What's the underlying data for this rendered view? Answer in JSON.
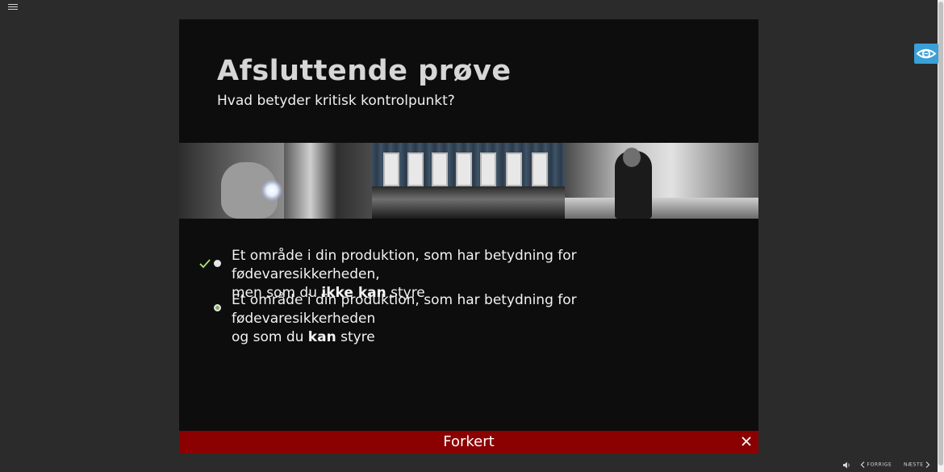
{
  "toolbar": {
    "menu_icon": "hamburger-menu-icon"
  },
  "slide": {
    "title": "Afsluttende prøve",
    "subtitle": "Hvad betyder kritisk kontrolpunkt?",
    "images": [
      {
        "name": "hand-with-light-photo"
      },
      {
        "name": "row-of-doors-photo"
      },
      {
        "name": "kitchen-chef-photo"
      }
    ],
    "options": [
      {
        "line1": "Et område i din produktion, som har betydning for fødevaresikkerheden,",
        "line2_pre": "men som du ",
        "line2_bold": "ikke kan",
        "line2_post": " styre",
        "marked_correct": true,
        "selected": false
      },
      {
        "line1": "Et område i din produktion, som har betydning for fødevaresikkerheden",
        "line2_pre": "og som du ",
        "line2_bold": "kan",
        "line2_post": " styre",
        "marked_correct": false,
        "selected": true
      }
    ],
    "feedback": {
      "text": "Forkert",
      "color": "#8b0000"
    }
  },
  "accessibility": {
    "icon": "eye-accessibility-icon",
    "color": "#3aa0d6"
  },
  "footer": {
    "volume_icon": "speaker-icon",
    "prev_label": "FORRIGE",
    "next_label": "NÆSTE"
  }
}
